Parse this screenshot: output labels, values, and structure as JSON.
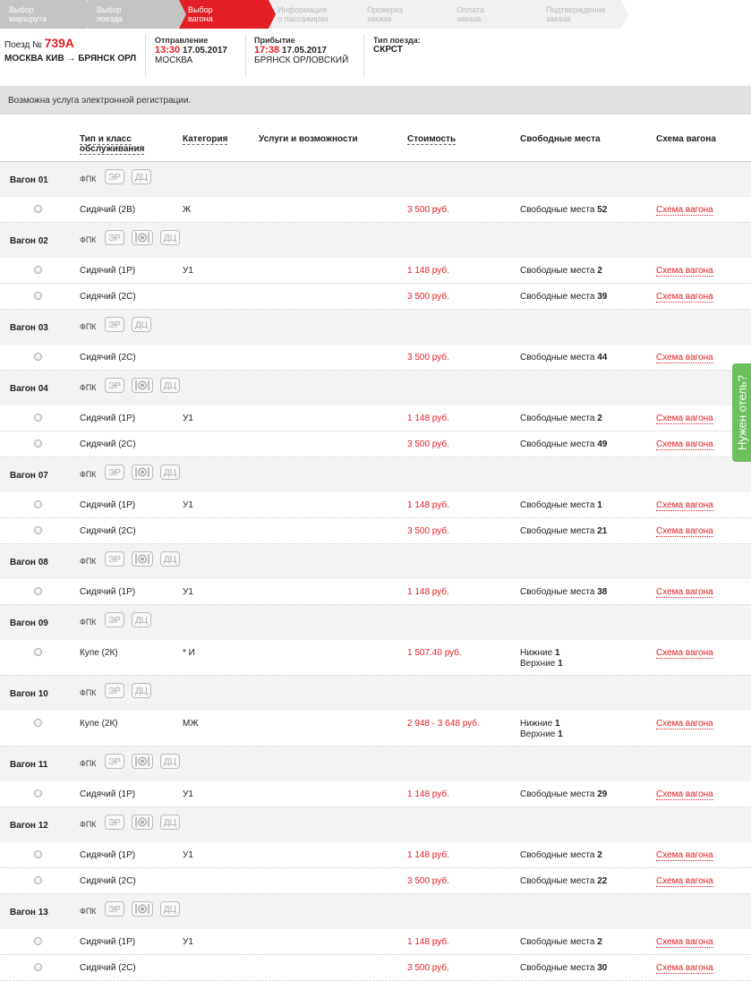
{
  "steps": [
    {
      "l1": "Выбор",
      "l2": "маршрута",
      "state": "done"
    },
    {
      "l1": "Выбор",
      "l2": "поезда",
      "state": "done"
    },
    {
      "l1": "Выбор",
      "l2": "вагона",
      "state": "active"
    },
    {
      "l1": "Информация",
      "l2": "о пассажирах",
      "state": "todo"
    },
    {
      "l1": "Проверка",
      "l2": "заказа",
      "state": "todo"
    },
    {
      "l1": "Оплата",
      "l2": "заказа",
      "state": "todo"
    },
    {
      "l1": "Подтверждение",
      "l2": "заказа",
      "state": "todo"
    }
  ],
  "train": {
    "num_label": "Поезд №",
    "num": "739А",
    "route": "МОСКВА КИВ → БРЯНСК ОРЛ",
    "departure_hdr": "Отправление",
    "dep_time": "13:30",
    "dep_date": "17.05.2017",
    "dep_station": "МОСКВА",
    "arrival_hdr": "Прибытие",
    "arr_time": "17:38",
    "arr_date": "17.05.2017",
    "arr_station": "БРЯНСК ОРЛОВСКИЙ",
    "type_hdr": "Тип поезда:",
    "type": "СКРСТ"
  },
  "notice": "Возможна услуга электронной регистрации.",
  "columns": {
    "type": "Тип и класс обслуживания",
    "category": "Категория",
    "services": "Услуги и возможности",
    "price": "Стоимость",
    "free": "Свободные места",
    "scheme": "Схема вагона"
  },
  "wagons": [
    {
      "name": "Вагон 01",
      "firm": "ФПК",
      "badges": [
        "ЭР",
        "ДЦ"
      ],
      "seats": [
        {
          "type": "Сидячий (2В)",
          "cat": "Ж",
          "price": "3 500 руб.",
          "free_label": "Свободные места",
          "free": "52"
        }
      ]
    },
    {
      "name": "Вагон 02",
      "firm": "ФПК",
      "badges": [
        "ЭР",
        "meal",
        "ДЦ"
      ],
      "seats": [
        {
          "type": "Сидячий (1Р)",
          "cat": "У1",
          "price": "1 148 руб.",
          "free_label": "Свободные места",
          "free": "2"
        },
        {
          "type": "Сидячий (2С)",
          "cat": "",
          "price": "3 500 руб.",
          "free_label": "Свободные места",
          "free": "39"
        }
      ]
    },
    {
      "name": "Вагон 03",
      "firm": "ФПК",
      "badges": [
        "ЭР",
        "ДЦ"
      ],
      "seats": [
        {
          "type": "Сидячий (2С)",
          "cat": "",
          "price": "3 500 руб.",
          "free_label": "Свободные места",
          "free": "44"
        }
      ]
    },
    {
      "name": "Вагон 04",
      "firm": "ФПК",
      "badges": [
        "ЭР",
        "meal",
        "ДЦ"
      ],
      "seats": [
        {
          "type": "Сидячий (1Р)",
          "cat": "У1",
          "price": "1 148 руб.",
          "free_label": "Свободные места",
          "free": "2"
        },
        {
          "type": "Сидячий (2С)",
          "cat": "",
          "price": "3 500 руб.",
          "free_label": "Свободные места",
          "free": "49"
        }
      ]
    },
    {
      "name": "Вагон 07",
      "firm": "ФПК",
      "badges": [
        "ЭР",
        "meal",
        "ДЦ"
      ],
      "seats": [
        {
          "type": "Сидячий (1Р)",
          "cat": "У1",
          "price": "1 148 руб.",
          "free_label": "Свободные места",
          "free": "1"
        },
        {
          "type": "Сидячий (2С)",
          "cat": "",
          "price": "3 500 руб.",
          "free_label": "Свободные места",
          "free": "21"
        }
      ]
    },
    {
      "name": "Вагон 08",
      "firm": "ФПК",
      "badges": [
        "ЭР",
        "meal",
        "ДЦ"
      ],
      "seats": [
        {
          "type": "Сидячий (1Р)",
          "cat": "У1",
          "price": "1 148 руб.",
          "free_label": "Свободные места",
          "free": "38"
        }
      ]
    },
    {
      "name": "Вагон 09",
      "firm": "ФПК",
      "badges": [
        "ЭР",
        "ДЦ"
      ],
      "seats": [
        {
          "type": "Купе (2К)",
          "cat": "* И",
          "price": "1 507.40 руб.",
          "lower_label": "Нижние",
          "lower": "1",
          "upper_label": "Верхние",
          "upper": "1"
        }
      ]
    },
    {
      "name": "Вагон 10",
      "firm": "ФПК",
      "badges": [
        "ЭР",
        "ДЦ"
      ],
      "seats": [
        {
          "type": "Купе (2К)",
          "cat": "МЖ",
          "price": "2 948 - 3 648 руб.",
          "lower_label": "Нижние",
          "lower": "1",
          "upper_label": "Верхние",
          "upper": "1"
        }
      ]
    },
    {
      "name": "Вагон 11",
      "firm": "ФПК",
      "badges": [
        "ЭР",
        "meal",
        "ДЦ"
      ],
      "seats": [
        {
          "type": "Сидячий (1Р)",
          "cat": "У1",
          "price": "1 148 руб.",
          "free_label": "Свободные места",
          "free": "29"
        }
      ]
    },
    {
      "name": "Вагон 12",
      "firm": "ФПК",
      "badges": [
        "ЭР",
        "meal",
        "ДЦ"
      ],
      "seats": [
        {
          "type": "Сидячий (1Р)",
          "cat": "У1",
          "price": "1 148 руб.",
          "free_label": "Свободные места",
          "free": "2"
        },
        {
          "type": "Сидячий (2С)",
          "cat": "",
          "price": "3 500 руб.",
          "free_label": "Свободные места",
          "free": "22"
        }
      ]
    },
    {
      "name": "Вагон 13",
      "firm": "ФПК",
      "badges": [
        "ЭР",
        "meal",
        "ДЦ"
      ],
      "seats": [
        {
          "type": "Сидячий (1Р)",
          "cat": "У1",
          "price": "1 148 руб.",
          "free_label": "Свободные места",
          "free": "2"
        },
        {
          "type": "Сидячий (2С)",
          "cat": "",
          "price": "3 500 руб.",
          "free_label": "Свободные места",
          "free": "30"
        }
      ]
    }
  ],
  "scheme_link": "Схема вагона",
  "hotel_tab": "Нужен отель?",
  "colors": {
    "accent": "#e31e24",
    "hotel": "#6cc05d"
  }
}
